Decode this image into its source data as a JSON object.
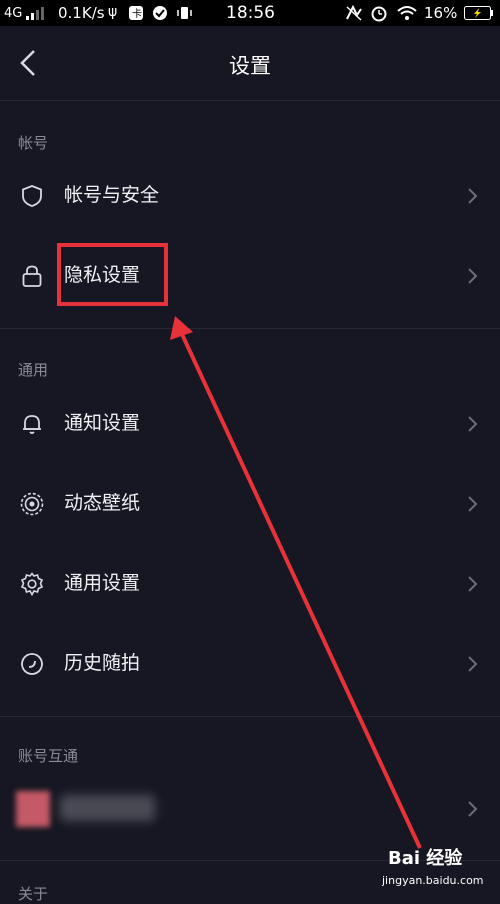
{
  "status_bar": {
    "network": "4G",
    "speed": "0.1K/s",
    "time": "18:56",
    "battery": "16%"
  },
  "header": {
    "title": "设置"
  },
  "sections": [
    {
      "title": "帐号",
      "items": [
        {
          "label": "帐号与安全",
          "icon": "shield-icon"
        },
        {
          "label": "隐私设置",
          "icon": "lock-icon"
        }
      ]
    },
    {
      "title": "通用",
      "items": [
        {
          "label": "通知设置",
          "icon": "bell-icon"
        },
        {
          "label": "动态壁纸",
          "icon": "live-wallpaper-icon"
        },
        {
          "label": "通用设置",
          "icon": "gear-icon"
        },
        {
          "label": "历史随拍",
          "icon": "history-icon"
        }
      ]
    },
    {
      "title": "账号互通",
      "items": []
    }
  ],
  "bottom_partial": "关于",
  "watermark": {
    "brand": "Bai 经验",
    "url": "jingyan.baidu.com"
  },
  "colors": {
    "background": "#161722",
    "highlight": "#e8323a",
    "text": "#f1f1f4",
    "muted": "#8a8b96"
  }
}
